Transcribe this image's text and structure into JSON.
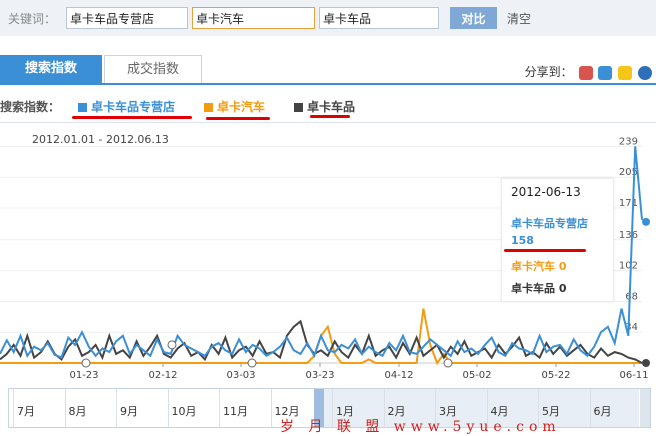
{
  "search": {
    "label": "关键词：",
    "keywords": [
      "卓卡车品专营店",
      "卓卡汽车",
      "卓卡车品"
    ],
    "compare_label": "对比",
    "clear_label": "清空"
  },
  "tabs": {
    "active": "搜索指数",
    "inactive": "成交指数",
    "share_label": "分享到："
  },
  "legend": {
    "title": "搜索指数：",
    "series": [
      {
        "name": "卓卡车品专营店",
        "color": "#3b8fd4"
      },
      {
        "name": "卓卡汽车",
        "color": "#f39c12"
      },
      {
        "name": "卓卡车品",
        "color": "#444444"
      }
    ]
  },
  "chart_data": {
    "type": "line",
    "date_range": "2012.01.01 - 2012.06.13",
    "x_ticks": [
      "01-23",
      "02-12",
      "03-03",
      "03-23",
      "04-12",
      "05-02",
      "05-22",
      "06-11"
    ],
    "y_ticks": [
      34,
      68,
      102,
      136,
      171,
      205,
      239
    ],
    "ylim": [
      0,
      256
    ],
    "series": [
      {
        "name": "卓卡车品专营店",
        "values": [
          10,
          25,
          12,
          30,
          8,
          18,
          14,
          22,
          9,
          6,
          28,
          20,
          34,
          18,
          8,
          16,
          12,
          24,
          30,
          10,
          20,
          14,
          8,
          26,
          12,
          10,
          30,
          20,
          16,
          12,
          8,
          18,
          22,
          14,
          10,
          26,
          12,
          20,
          16,
          8,
          12,
          18,
          28,
          14,
          10,
          22,
          8,
          30,
          14,
          12,
          20,
          16,
          26,
          10,
          18,
          12,
          8,
          22,
          14,
          30,
          12,
          10,
          18,
          26,
          20,
          14,
          8,
          24,
          12,
          16,
          10,
          20,
          28,
          12,
          8,
          22,
          16,
          14,
          10,
          30,
          12,
          18,
          20,
          10,
          26,
          14,
          8,
          18,
          34,
          40,
          22,
          60,
          30,
          239,
          158
        ]
      },
      {
        "name": "卓卡汽车",
        "values": [
          0,
          0,
          0,
          0,
          0,
          0,
          0,
          0,
          0,
          0,
          0,
          0,
          0,
          0,
          0,
          0,
          0,
          0,
          0,
          0,
          0,
          0,
          0,
          0,
          0,
          0,
          0,
          0,
          0,
          0,
          0,
          0,
          0,
          0,
          0,
          0,
          0,
          0,
          0,
          0,
          0,
          0,
          0,
          0,
          0,
          0,
          8,
          30,
          40,
          10,
          0,
          0,
          0,
          0,
          4,
          0,
          0,
          0,
          0,
          0,
          0,
          0,
          60,
          20,
          0,
          10,
          0,
          0,
          0,
          0,
          0,
          0,
          0,
          0,
          0,
          0,
          0,
          0,
          0,
          0,
          0,
          0,
          0,
          0,
          0,
          0,
          0,
          0,
          0,
          0,
          0,
          0,
          0,
          0,
          0
        ]
      },
      {
        "name": "卓卡车品",
        "values": [
          4,
          10,
          20,
          8,
          30,
          6,
          12,
          24,
          10,
          4,
          18,
          26,
          8,
          12,
          20,
          6,
          30,
          10,
          14,
          6,
          24,
          8,
          18,
          30,
          10,
          6,
          16,
          22,
          8,
          12,
          4,
          20,
          10,
          28,
          6,
          14,
          18,
          8,
          24,
          10,
          12,
          6,
          30,
          40,
          46,
          20,
          10,
          14,
          8,
          24,
          12,
          6,
          20,
          10,
          30,
          8,
          14,
          18,
          6,
          22,
          10,
          28,
          8,
          14,
          20,
          6,
          18,
          10,
          24,
          8,
          12,
          16,
          6,
          20,
          10,
          18,
          28,
          8,
          12,
          6,
          22,
          10,
          18,
          8,
          14,
          20,
          10,
          6,
          16,
          8,
          12,
          10,
          6,
          4,
          0
        ]
      }
    ],
    "tooltip": {
      "date": "2012-06-13",
      "series1_name": "卓卡车品专营店",
      "series1_value": "158",
      "series2_text": "卓卡汽车 0",
      "series3_text": "卓卡车品 0"
    }
  },
  "navigator": {
    "months": [
      "7月",
      "8月",
      "9月",
      "10月",
      "11月",
      "12月",
      "1月",
      "2月",
      "3月",
      "4月",
      "5月",
      "6月"
    ]
  },
  "watermark": "岁 月 联 盟 www.5yue.com"
}
